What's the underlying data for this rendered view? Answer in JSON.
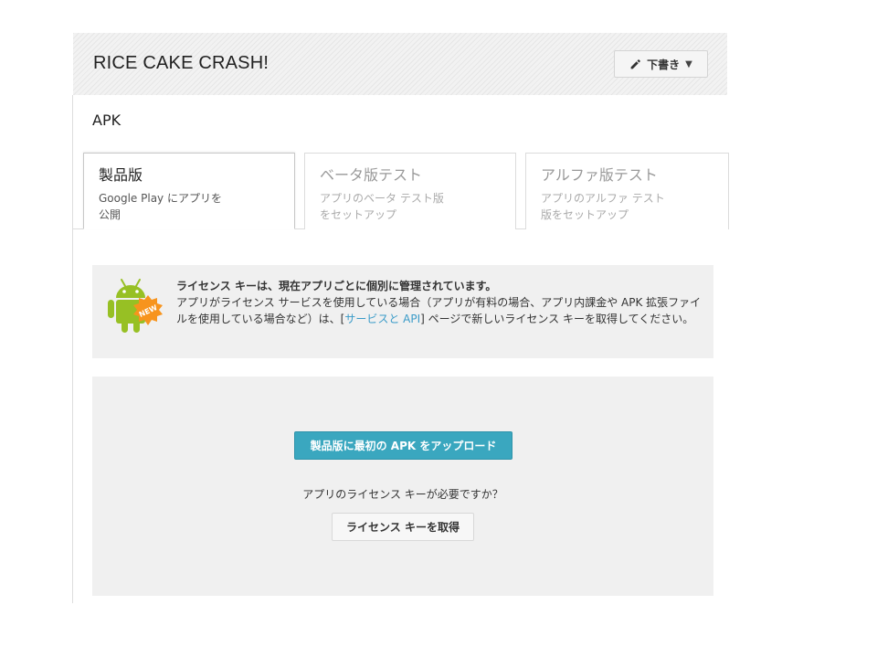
{
  "header": {
    "app_title": "RICE CAKE CRASH!",
    "draft_button": {
      "icon": "pencil-icon",
      "label": "下書き",
      "caret": "▼"
    }
  },
  "section": {
    "title": "APK"
  },
  "tabs": [
    {
      "title": "製品版",
      "description": "Google Play にアプリを\n公開",
      "active": true
    },
    {
      "title": "ベータ版テスト",
      "description": "アプリのベータ テスト版\nをセットアップ",
      "active": false
    },
    {
      "title": "アルファ版テスト",
      "description": "アプリのアルファ テスト\n版をセットアップ",
      "active": false
    }
  ],
  "notice": {
    "icon": "android-new-icon",
    "badge": "NEW",
    "heading": "ライセンス キーは、現在アプリごとに個別に管理されています。",
    "body_before_link": "アプリがライセンス サービスを使用している場合（アプリが有料の場合、アプリ内課金や APK 拡張ファイルを使用している場合など）は、[",
    "link_text": "サービスと API",
    "body_after_link": "] ページで新しいライセンス キーを取得してください。"
  },
  "upload": {
    "upload_button_label": "製品版に最初の APK をアップロード",
    "license_question": "アプリのライセンス キーが必要ですか？",
    "license_button_label": "ライセンス キーを取得"
  },
  "colors": {
    "accent": "#3aa7bf",
    "link": "#3a9bc8",
    "android_green": "#97c024",
    "badge_orange": "#f7941d",
    "panel_bg": "#f0f0f0"
  }
}
